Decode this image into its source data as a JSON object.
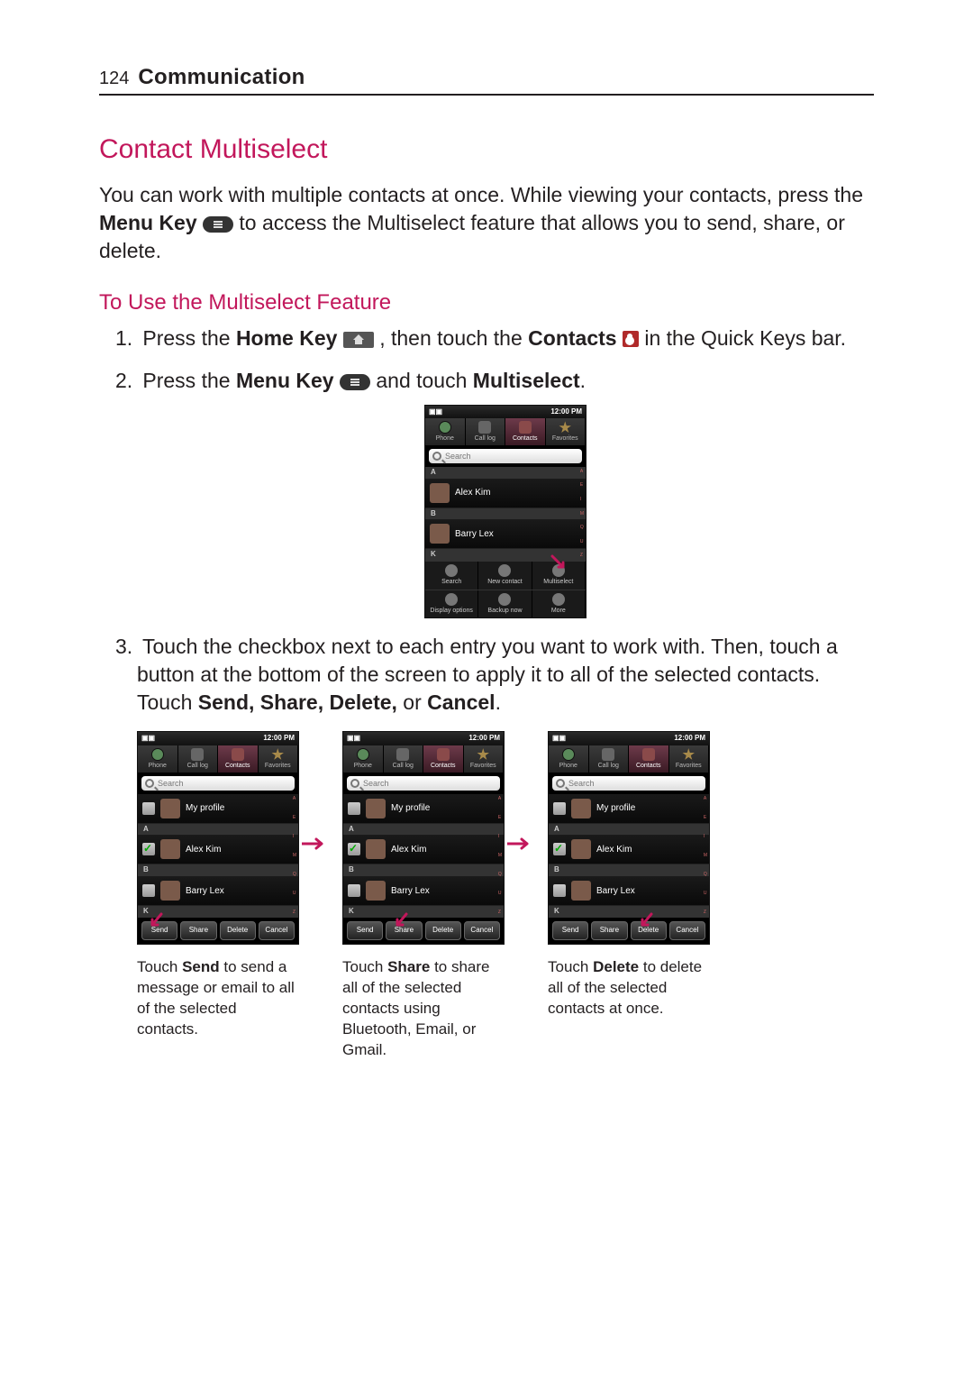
{
  "page": {
    "number": "124",
    "chapter": "Communication"
  },
  "section": {
    "title": "Contact Multiselect",
    "intro_part1": "You can work with multiple contacts at once. While viewing your contacts, press the ",
    "intro_bold1": "Menu Key",
    "intro_part2": " to access the Multiselect feature that allows you to send, share, or delete.",
    "subheading": "To Use the Multiselect Feature",
    "step1_a": "Press the ",
    "step1_bold1": "Home Key",
    "step1_b": ", then touch the ",
    "step1_bold2": "Contacts",
    "step1_c": " in the Quick Keys bar.",
    "step2_a": "Press the ",
    "step2_bold1": "Menu Key",
    "step2_b": " and touch ",
    "step2_bold2": "Multiselect",
    "step2_c": ".",
    "step3_a": "Touch the checkbox next to each entry you want to work with. Then, touch a button at the bottom of the screen to apply it to all of the selected contacts. Touch ",
    "step3_bold": "Send, Share, Delete,",
    "step3_b": " or ",
    "step3_bold2": "Cancel",
    "step3_c": "."
  },
  "screenshot": {
    "status_time": "12:00 PM",
    "tabs": {
      "phone": "Phone",
      "calllog": "Call log",
      "contacts": "Contacts",
      "favorites": "Favorites"
    },
    "search_placeholder": "Search",
    "letters": {
      "a": "A",
      "b": "B",
      "k": "K"
    },
    "contacts": {
      "profile": "My profile",
      "c1": "Alex Kim",
      "c2": "Barry Lex"
    },
    "menu": {
      "search": "Search",
      "new": "New contact",
      "multi": "Multiselect",
      "display": "Display options",
      "backup": "Backup now",
      "more": "More"
    },
    "actions": {
      "send": "Send",
      "share": "Share",
      "delete": "Delete",
      "cancel": "Cancel"
    }
  },
  "captions": {
    "send_a": "Touch ",
    "send_bold": "Send",
    "send_b": " to send a message or email to all of the selected contacts.",
    "share_a": "Touch ",
    "share_bold": "Share",
    "share_b": " to share all of the selected contacts using Bluetooth, Email, or Gmail.",
    "delete_a": "Touch ",
    "delete_bold": "Delete",
    "delete_b": " to delete all of the selected contacts at once."
  }
}
